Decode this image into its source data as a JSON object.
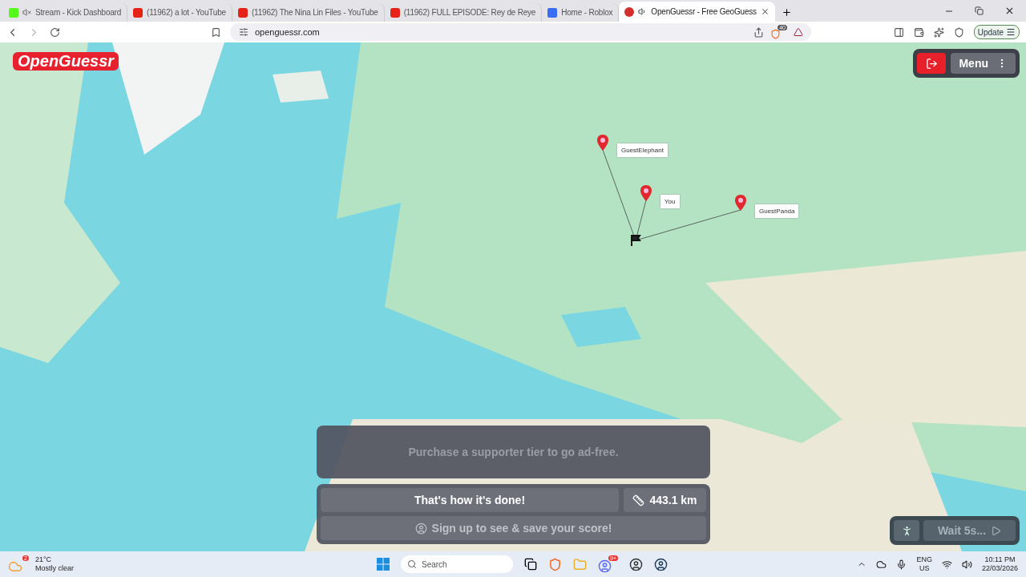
{
  "browser": {
    "tabs": [
      {
        "title": "Stream - Kick Dashboard",
        "kind": "kick",
        "selected": false,
        "muted": true
      },
      {
        "title": "(11962) a lot - YouTube",
        "kind": "youtube",
        "selected": false,
        "muted": false
      },
      {
        "title": "(11962) The Nina Lin Files - YouTube",
        "kind": "youtube",
        "selected": false,
        "muted": false
      },
      {
        "title": "(11962) FULL EPISODE: Rey de Reye",
        "kind": "youtube",
        "selected": false,
        "muted": false
      },
      {
        "title": "Home - Roblox",
        "kind": "roblox",
        "selected": false,
        "muted": false
      },
      {
        "title": "OpenGuessr - Free GeoGuess",
        "kind": "openguessr",
        "selected": true,
        "muted": false
      }
    ],
    "address": "openguessr.com",
    "shield_badge": "40",
    "update_label": "Update"
  },
  "game": {
    "logo": "OpenGuessr",
    "menu_label": "Menu",
    "markers": [
      {
        "label": "GuestElephant"
      },
      {
        "label": "You"
      },
      {
        "label": "GuestPanda"
      }
    ],
    "ad_text": "Purchase a supporter tier to go ad-free.",
    "result": "That's how it's done!",
    "distance": "443.1 km",
    "signup": "Sign up to see & save your score!",
    "next_label": "Wait 5s..."
  },
  "taskbar": {
    "weather_badge": "2",
    "temperature": "21°C",
    "weather": "Mostly clear",
    "search_placeholder": "Search",
    "discord_badge": "9+",
    "lang": "ENG",
    "region": "US",
    "time": "10:11 PM",
    "date": "22/03/2026"
  }
}
